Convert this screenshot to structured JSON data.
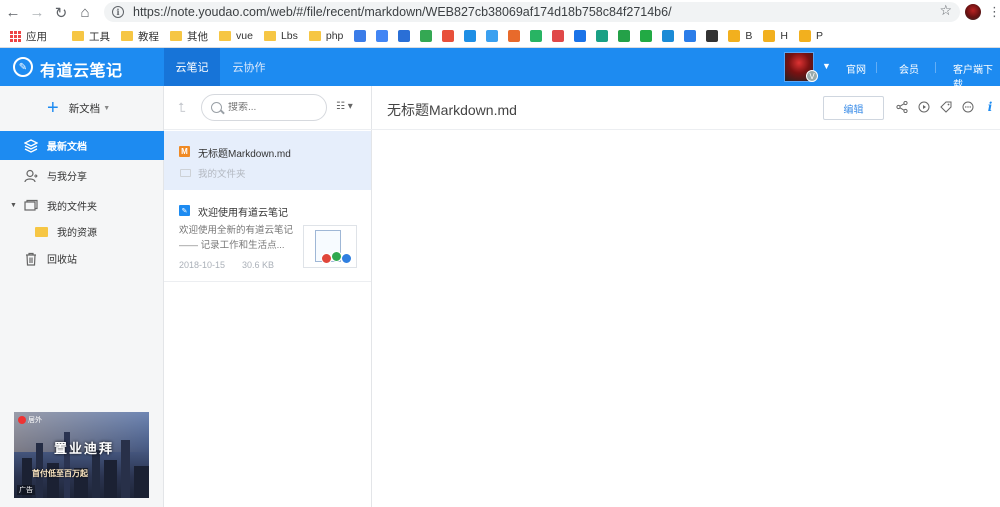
{
  "browser": {
    "url": "https://note.youdao.com/web/#/file/recent/markdown/WEB827cb38069af174d18b758c84f2714b6/",
    "bookmarks": [
      {
        "label": "应用",
        "icon": "apps-grid-icon"
      },
      {
        "label": "工具",
        "icon": "folder-icon"
      },
      {
        "label": "教程",
        "icon": "folder-icon"
      },
      {
        "label": "其他",
        "icon": "folder-icon"
      },
      {
        "label": "vue",
        "icon": "folder-icon"
      },
      {
        "label": "Lbs",
        "icon": "folder-icon"
      },
      {
        "label": "php",
        "icon": "folder-icon"
      },
      {
        "label": "B",
        "icon": "site-icon"
      },
      {
        "label": "H",
        "icon": "site-icon"
      },
      {
        "label": "P",
        "icon": "site-icon"
      }
    ],
    "site_icon_colors": [
      "#3b7ce8",
      "#4285f4",
      "#2a6fd6",
      "#34a853",
      "#e8503a",
      "#1f8fe5",
      "#3aa0f0",
      "#e86a2b",
      "#28b463",
      "#e04848",
      "#1a73e8",
      "#1aa085",
      "#24a148",
      "#22aa44",
      "#1b8bd6",
      "#2b7de9",
      "#333333"
    ]
  },
  "header": {
    "logo": "有道云笔记",
    "tabs": [
      "云笔记",
      "云协作"
    ],
    "avatar_badge": "V",
    "links": [
      "官网",
      "会员",
      "客户端下载"
    ],
    "accent": "#1d8bf1"
  },
  "sidebar": {
    "new_doc": "新文档",
    "items": [
      {
        "label": "最新文档",
        "icon": "layers-icon",
        "active": true
      },
      {
        "label": "与我分享",
        "icon": "share-user-icon",
        "active": false
      },
      {
        "label": "我的文件夹",
        "icon": "folders-icon",
        "active": false
      },
      {
        "label": "我的资源",
        "icon": "folder-icon",
        "active": false
      },
      {
        "label": "回收站",
        "icon": "trash-icon",
        "active": false
      }
    ],
    "ad": {
      "brand": "居外",
      "title": "置业迪拜",
      "subtitle": "首付低至百万起",
      "label": "广告"
    }
  },
  "list": {
    "search_placeholder": "搜索...",
    "docs": [
      {
        "title": "无标题Markdown.md",
        "folder": "我的文件夹",
        "type": "markdown"
      },
      {
        "title": "欢迎使用有道云笔记",
        "snippet_line1": "欢迎使用全新的有道云笔记",
        "snippet_line2": "—— 记录工作和生活点...",
        "date": "2018-10-15",
        "size": "30.6 KB",
        "type": "note"
      }
    ]
  },
  "editor": {
    "title": "无标题Markdown.md",
    "edit_button": "编辑",
    "toolbar_icons": [
      "share-icon",
      "play-icon",
      "tag-icon",
      "more-icon",
      "info-icon"
    ]
  }
}
